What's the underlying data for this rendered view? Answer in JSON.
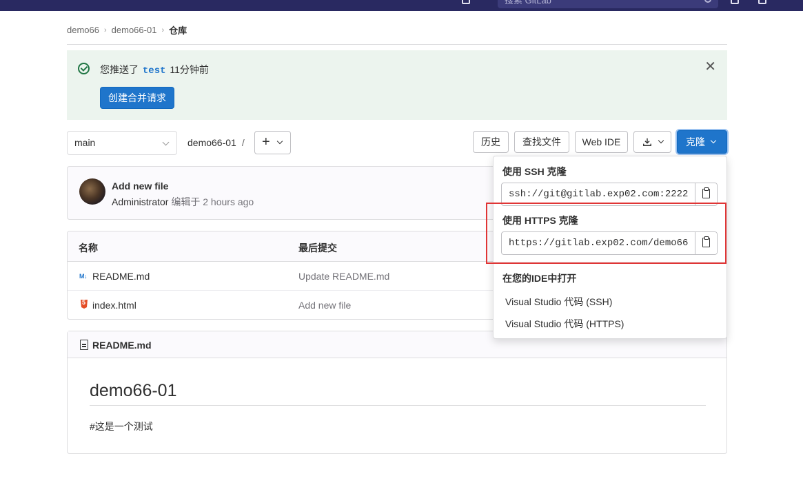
{
  "topbar": {
    "search_placeholder": "搜索 GitLab"
  },
  "breadcrumb": {
    "items": [
      "demo66",
      "demo66-01",
      "仓库"
    ]
  },
  "alert": {
    "text_before": "您推送了",
    "branch": "test",
    "text_after": "11分钟前",
    "create_mr_label": "创建合并请求"
  },
  "toolbar": {
    "branch": "main",
    "path": "demo66-01",
    "path_sep": "/",
    "history_label": "历史",
    "find_file_label": "查找文件",
    "web_ide_label": "Web IDE",
    "clone_label": "克隆"
  },
  "last_commit": {
    "title": "Add new file",
    "author": "Administrator",
    "action": "编辑于",
    "time": "2 hours ago"
  },
  "files": {
    "headers": {
      "name": "名称",
      "last_commit": "最后提交"
    },
    "rows": [
      {
        "name": "README.md",
        "commit": "Update README.md",
        "icon": "markdown-icon"
      },
      {
        "name": "index.html",
        "commit": "Add new file",
        "icon": "html5-icon"
      }
    ]
  },
  "readme": {
    "filename": "README.md",
    "heading": "demo66-01",
    "paragraph": "#这是一个测试"
  },
  "clone_dropdown": {
    "ssh_label": "使用 SSH 克隆",
    "ssh_url": "ssh://git@gitlab.exp02.com:2222",
    "https_label": "使用 HTTPS 克隆",
    "https_url": "https://gitlab.exp02.com/demo66",
    "ide_label": "在您的IDE中打开",
    "ide_items": [
      "Visual Studio 代码 (SSH)",
      "Visual Studio 代码 (HTTPS)"
    ]
  },
  "colors": {
    "primary": "#1f75cb",
    "alert_bg": "#ecf4ee",
    "success": "#217645",
    "highlight": "#e03535",
    "topbar": "#292961"
  }
}
